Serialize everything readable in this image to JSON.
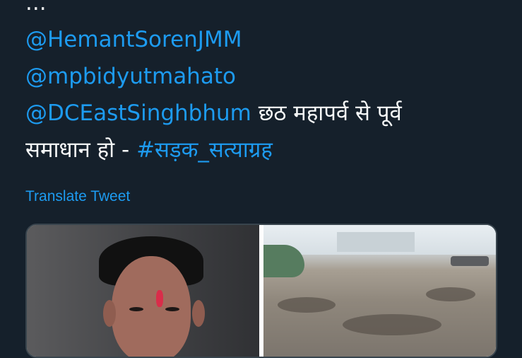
{
  "tweet": {
    "top_partial_line": "...",
    "mentions": {
      "hemant": "@HemantSorenJMM",
      "bidyut": "@mpbidyutmahato",
      "dc": "@DCEastSinghbhum"
    },
    "line_3_tail": "छठ महापर्व से पूर्व",
    "line_4_text": "समाधान हो - ",
    "hashtag": "#सड़क_सत्याग्रह",
    "translate_label": "Translate Tweet"
  },
  "media": {
    "items": [
      {
        "kind": "portrait"
      },
      {
        "kind": "road"
      }
    ]
  },
  "colors": {
    "background": "#15202b",
    "text": "#f7f9f9",
    "link": "#1d9bf0",
    "border": "#38444d"
  }
}
